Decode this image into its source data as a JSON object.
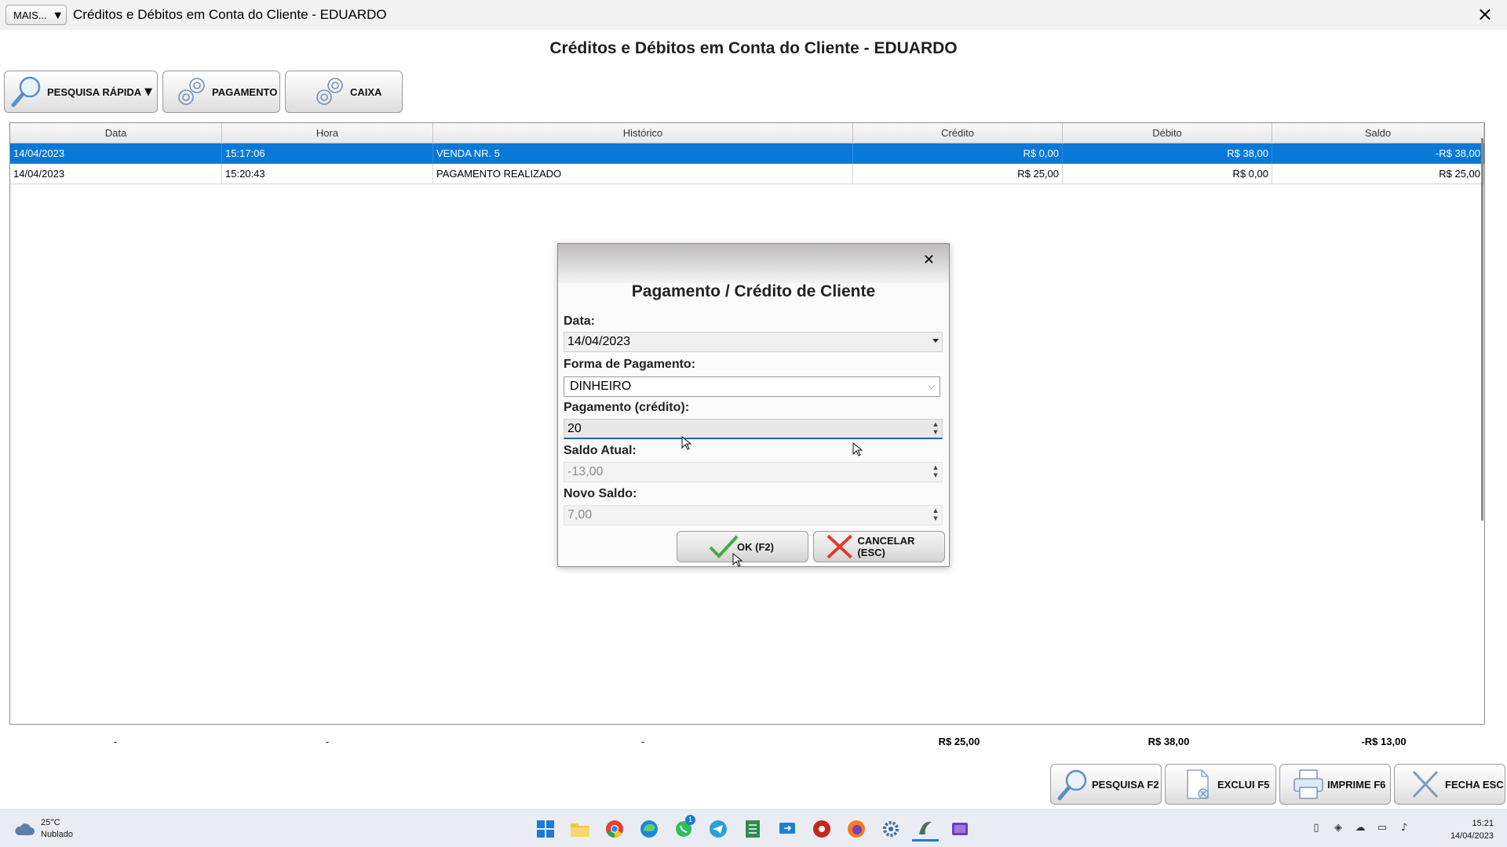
{
  "window": {
    "menu_button": "MAIS...",
    "title": "Créditos e Débitos em Conta do Cliente - EDUARDO",
    "close_icon": "close-icon"
  },
  "page_heading": "Créditos e Débitos em Conta do Cliente - EDUARDO",
  "toolbar": {
    "quick_search": "PESQUISA RÁPIDA",
    "payment": "PAGAMENTO",
    "cash": "CAIXA"
  },
  "grid": {
    "columns": [
      "Data",
      "Hora",
      "Histórico",
      "Crédito",
      "Débito",
      "Saldo"
    ],
    "rows": [
      {
        "data": "14/04/2023",
        "hora": "15:17:06",
        "historico": "VENDA NR. 5",
        "credito": "R$ 0,00",
        "debito": "R$ 38,00",
        "saldo": "-R$ 38,00",
        "selected": true
      },
      {
        "data": "14/04/2023",
        "hora": "15:20:43",
        "historico": "PAGAMENTO REALIZADO",
        "credito": "R$ 25,00",
        "debito": "R$ 0,00",
        "saldo": "R$ 25,00",
        "selected": false
      }
    ]
  },
  "totals": {
    "data": "-",
    "hora": "-",
    "historico": "-",
    "credito": "R$ 25,00",
    "debito": "R$ 38,00",
    "saldo": "-R$ 13,00"
  },
  "bottom_buttons": {
    "search": "PESQUISA F2",
    "delete": "EXCLUI F5",
    "print": "IMPRIME F6",
    "close": "FECHA ESC"
  },
  "dialog": {
    "title": "Pagamento / Crédito de Cliente",
    "data_label": "Data:",
    "data_value": "14/04/2023",
    "forma_label": "Forma de Pagamento:",
    "forma_value": "DINHEIRO",
    "pagamento_label": "Pagamento (crédito):",
    "pagamento_value": "20",
    "saldo_atual_label": "Saldo Atual:",
    "saldo_atual_value": "-13,00",
    "novo_saldo_label": "Novo Saldo:",
    "novo_saldo_value": "7,00",
    "ok_button": "OK (F2)",
    "cancel_button": "CANCELAR (ESC)"
  },
  "taskbar": {
    "temperature": "25°C",
    "weather": "Nublado",
    "time": "15:21",
    "date": "14/04/2023",
    "whatsapp_badge": "1"
  },
  "colors": {
    "selected_row": "#0a78d7",
    "active_underline": "#1e63b8",
    "ok_check": "#3fae3f",
    "cancel_x": "#e03a2f"
  }
}
